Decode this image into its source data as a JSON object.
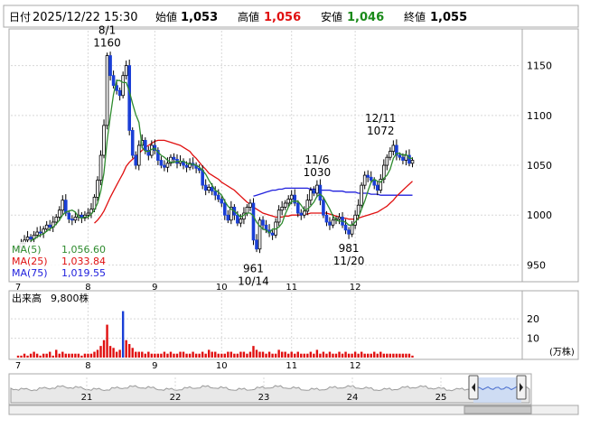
{
  "header": {
    "date_label": "日付",
    "datetime": "2025/12/22 15:30",
    "open_label": "始値",
    "open_value": "1,053",
    "high_label": "高値",
    "high_value": "1,056",
    "low_label": "安値",
    "low_value": "1,046",
    "close_label": "終値",
    "close_value": "1,055"
  },
  "colors": {
    "up_candle": "#ffffff",
    "down_candle": "#1a3fd6",
    "ma5": "#2e8b2e",
    "ma25": "#e01010",
    "ma75": "#2020dd",
    "volume": "#e01010",
    "volume_highlight": "#1a3fd6",
    "high_value": "#e01010",
    "low_value": "#1a8a1a"
  },
  "chart_data": [
    {
      "type": "candlestick",
      "y_ticks": [
        950,
        1000,
        1050,
        1100,
        1150
      ],
      "ylim": [
        935,
        1185
      ],
      "month_labels": [
        "7",
        "8",
        "9",
        "10",
        "11",
        "12"
      ],
      "month_starts": [
        0,
        22,
        43,
        64,
        86,
        106
      ],
      "n_days": 125,
      "annotations": [
        {
          "date": "8/1",
          "value": "1160",
          "index": 28,
          "position": "above"
        },
        {
          "date": "12/11",
          "value": "1072",
          "index": 114,
          "position": "above"
        },
        {
          "date": "11/6",
          "value": "1030",
          "index": 94,
          "position": "above"
        },
        {
          "date": "10/14",
          "value": "961",
          "index": 74,
          "position": "below"
        },
        {
          "date": "11/20",
          "value": "981",
          "index": 104,
          "position": "below"
        }
      ],
      "legend": [
        {
          "label": "MA(5)",
          "value": "1,056.60",
          "color_key": "ma5"
        },
        {
          "label": "MA(25)",
          "value": "1,033.84",
          "color_key": "ma25"
        },
        {
          "label": "MA(75)",
          "value": "1,019.55",
          "color_key": "ma75"
        }
      ],
      "close_series": [
        968,
        972,
        975,
        978,
        976,
        980,
        983,
        982,
        986,
        990,
        988,
        993,
        998,
        1005,
        1015,
        1002,
        996,
        995,
        998,
        1000,
        997,
        1000,
        1002,
        1006,
        1018,
        1035,
        1060,
        1090,
        1160,
        1140,
        1130,
        1125,
        1120,
        1140,
        1150,
        1085,
        1060,
        1050,
        1070,
        1075,
        1065,
        1060,
        1070,
        1065,
        1055,
        1050,
        1048,
        1052,
        1058,
        1056,
        1052,
        1054,
        1050,
        1048,
        1052,
        1050,
        1047,
        1045,
        1030,
        1025,
        1028,
        1024,
        1020,
        1016,
        1012,
        1000,
        995,
        1008,
        1000,
        992,
        996,
        1002,
        1008,
        1012,
        975,
        966,
        995,
        990,
        985,
        982,
        980,
        993,
        1005,
        1008,
        1012,
        1016,
        1020,
        1012,
        1002,
        1000,
        1004,
        1015,
        1025,
        1022,
        1030,
        1015,
        1000,
        993,
        990,
        995,
        996,
        998,
        990,
        985,
        981,
        990,
        1000,
        1010,
        1030,
        1040,
        1038,
        1035,
        1030,
        1025,
        1036,
        1050,
        1058,
        1064,
        1070,
        1060,
        1058,
        1055,
        1060,
        1052,
        1055
      ],
      "ma5_series": [
        null,
        null,
        null,
        null,
        974,
        976,
        978,
        980,
        981,
        984,
        986,
        988,
        991,
        995,
        1000,
        1003,
        1004,
        1005,
        1003,
        998,
        997,
        998,
        998,
        1001,
        1005,
        1012,
        1024,
        1042,
        1075,
        1099,
        1121,
        1135,
        1135,
        1133,
        1133,
        1124,
        1112,
        1101,
        1093,
        1068,
        1064,
        1064,
        1066,
        1067,
        1063,
        1060,
        1058,
        1055,
        1053,
        1053,
        1054,
        1054,
        1054,
        1052,
        1051,
        1051,
        1050,
        1048,
        1045,
        1041,
        1035,
        1030,
        1025,
        1023,
        1020,
        1014,
        1009,
        1006,
        1004,
        1001,
        998,
        1000,
        1002,
        1002,
        999,
        993,
        989,
        986,
        985,
        982,
        986,
        986,
        988,
        992,
        1001,
        1008,
        1014,
        1014,
        1014,
        1010,
        1005,
        1006,
        1009,
        1013,
        1019,
        1021,
        1018,
        1012,
        1006,
        999,
        995,
        994,
        994,
        993,
        990,
        990,
        993,
        997,
        1006,
        1014,
        1024,
        1033,
        1036,
        1034,
        1033,
        1037,
        1040,
        1046,
        1057,
        1062,
        1062,
        1060,
        1061,
        1057,
        1057
      ],
      "ma25_series": [
        null,
        null,
        null,
        null,
        null,
        null,
        null,
        null,
        null,
        null,
        null,
        null,
        null,
        null,
        null,
        null,
        null,
        null,
        null,
        null,
        null,
        null,
        null,
        null,
        992,
        995,
        999,
        1004,
        1011,
        1018,
        1024,
        1030,
        1036,
        1042,
        1049,
        1053,
        1056,
        1059,
        1062,
        1065,
        1068,
        1070,
        1072,
        1074,
        1075,
        1075,
        1075,
        1074,
        1073,
        1072,
        1071,
        1070,
        1068,
        1066,
        1064,
        1060,
        1057,
        1053,
        1049,
        1046,
        1042,
        1040,
        1038,
        1036,
        1033,
        1031,
        1029,
        1027,
        1025,
        1022,
        1019,
        1016,
        1013,
        1011,
        1008,
        1006,
        1004,
        1002,
        1001,
        1000,
        999,
        998,
        998,
        998,
        999,
        999,
        1000,
        1000,
        1000,
        1000,
        1001,
        1001,
        1002,
        1002,
        1002,
        1002,
        1002,
        1002,
        1001,
        1000,
        999,
        998,
        997,
        997,
        996,
        996,
        996,
        997,
        998,
        999,
        1000,
        1001,
        1002,
        1003,
        1005,
        1007,
        1009,
        1012,
        1015,
        1019,
        1022,
        1025,
        1028,
        1031,
        1034
      ],
      "ma75_series": [
        null,
        null,
        null,
        null,
        null,
        null,
        null,
        null,
        null,
        null,
        null,
        null,
        null,
        null,
        null,
        null,
        null,
        null,
        null,
        null,
        null,
        null,
        null,
        null,
        null,
        null,
        null,
        null,
        null,
        null,
        null,
        null,
        null,
        null,
        null,
        null,
        null,
        null,
        null,
        null,
        null,
        null,
        null,
        null,
        null,
        null,
        null,
        null,
        null,
        null,
        null,
        null,
        null,
        null,
        null,
        null,
        null,
        null,
        null,
        null,
        null,
        null,
        null,
        null,
        null,
        null,
        null,
        null,
        null,
        null,
        null,
        null,
        null,
        null,
        1019,
        1020,
        1021,
        1022,
        1023,
        1024,
        1025,
        1025,
        1026,
        1026,
        1027,
        1027,
        1027,
        1027,
        1027,
        1027,
        1027,
        1027,
        1026,
        1026,
        1026,
        1025,
        1025,
        1025,
        1025,
        1024,
        1024,
        1024,
        1024,
        1023,
        1023,
        1023,
        1023,
        1022,
        1022,
        1022,
        1022,
        1021,
        1021,
        1021,
        1020,
        1020,
        1020,
        1020,
        1020,
        1020,
        1020,
        1020,
        1020,
        1020,
        1020
      ]
    },
    {
      "type": "bar",
      "title": "出来高",
      "latest_volume": "9,800株",
      "unit_label": "(万株)",
      "y_ticks": [
        10,
        20
      ],
      "ylim": [
        0,
        28
      ],
      "month_labels": [
        "7",
        "8",
        "9",
        "10",
        "11",
        "12"
      ],
      "values": [
        1,
        1,
        2,
        1,
        2,
        3,
        2,
        1,
        2,
        2,
        3,
        1,
        4,
        2,
        3,
        2,
        2,
        2,
        2,
        2,
        1,
        2,
        2,
        2,
        3,
        4,
        6,
        9,
        17,
        6,
        5,
        3,
        4,
        24,
        9,
        7,
        5,
        3,
        3,
        3,
        2,
        3,
        2,
        2,
        2,
        2,
        3,
        2,
        3,
        2,
        2,
        3,
        3,
        2,
        2,
        3,
        2,
        2,
        3,
        2,
        4,
        3,
        3,
        2,
        2,
        2,
        3,
        3,
        2,
        2,
        3,
        3,
        2,
        3,
        6,
        4,
        3,
        3,
        2,
        3,
        2,
        2,
        4,
        3,
        3,
        2,
        3,
        2,
        3,
        2,
        2,
        2,
        3,
        2,
        4,
        2,
        3,
        2,
        3,
        2,
        2,
        3,
        2,
        3,
        2,
        2,
        3,
        2,
        3,
        2,
        2,
        2,
        3,
        2,
        3,
        2,
        2,
        2,
        2,
        2,
        2,
        2,
        2,
        2,
        1
      ]
    },
    {
      "type": "area",
      "title": "navigator",
      "x_labels": [
        "21",
        "22",
        "23",
        "24",
        "25"
      ]
    }
  ]
}
